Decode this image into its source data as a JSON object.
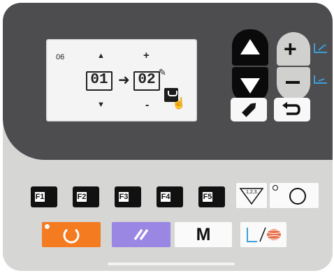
{
  "lcd": {
    "program_number": "06",
    "from_value": "01",
    "to_value": "02",
    "up_symbol": "+",
    "down_symbol": "-"
  },
  "keys": {
    "m_label": "M",
    "f_keys": [
      "F1",
      "F2",
      "F3",
      "F4",
      "F5"
    ],
    "counter_label": "1,2,3.."
  },
  "colors": {
    "orange": "#f47b20",
    "purple": "#9a86e3"
  },
  "icons": {
    "up": "up-triangle-icon",
    "down": "down-triangle-icon",
    "plus": "plus-icon",
    "minus": "minus-icon",
    "edit": "pencil-icon",
    "return": "return-icon",
    "reset": "circle-arrow-icon",
    "slash": "double-slash-icon",
    "bobbin": "bobbin-icon",
    "circle": "circle-icon",
    "hand": "hand-cursor-icon"
  }
}
